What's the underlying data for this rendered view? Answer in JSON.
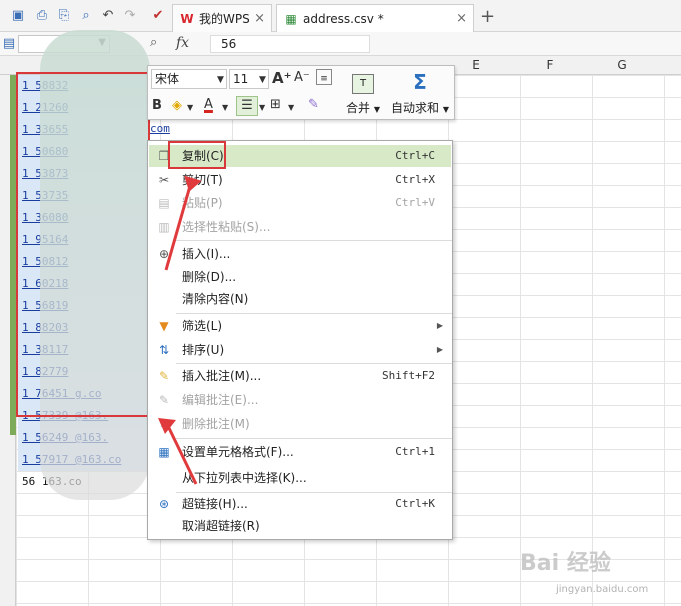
{
  "titlebar": {
    "tabs": [
      {
        "label": "我的WPS",
        "close": "×"
      },
      {
        "label": "address.csv *",
        "close": "×"
      }
    ],
    "new_tab": "+"
  },
  "formula_bar": {
    "fx_label": "fx",
    "value": "56"
  },
  "columns": [
    "E",
    "F",
    "G"
  ],
  "cells": [
    "1 58832",
    "1 21260",
    "1 33655",
    "1 50680",
    "1 53873",
    "1 53735",
    "1 36080",
    "1 95164",
    "1 50812",
    "1 60218",
    "1 56819",
    "1 88203",
    "1 38117",
    "1 82779",
    "1 76451 g.co",
    "1 57339 @163.",
    "1 56249 @163.",
    "1 57917 @163.co",
    "56 163.co"
  ],
  "row_extras": {
    "r2": "com",
    "r3": "com"
  },
  "format_toolbar": {
    "font_name": "宋体",
    "font_size": "11",
    "merge_label": "合并",
    "autosum_label": "自动求和"
  },
  "context_menu": {
    "items": [
      {
        "label": "复制(C)",
        "shortcut": "Ctrl+C",
        "icon": "copy-icon",
        "disabled": false,
        "highlighted": true
      },
      {
        "label": "剪切(T)",
        "shortcut": "Ctrl+X",
        "icon": "scissors-icon",
        "disabled": false
      },
      {
        "label": "粘贴(P)",
        "shortcut": "Ctrl+V",
        "icon": "paste-icon",
        "disabled": true
      },
      {
        "label": "选择性粘贴(S)...",
        "shortcut": "",
        "icon": "paste-special-icon",
        "disabled": true
      },
      {
        "label": "插入(I)...",
        "shortcut": "",
        "icon": "insert-icon",
        "disabled": false
      },
      {
        "label": "删除(D)...",
        "shortcut": "",
        "icon": "",
        "disabled": false
      },
      {
        "label": "清除内容(N)",
        "shortcut": "",
        "icon": "",
        "disabled": false
      },
      {
        "label": "筛选(L)",
        "shortcut": "",
        "icon": "filter-icon",
        "disabled": false,
        "submenu": true
      },
      {
        "label": "排序(U)",
        "shortcut": "",
        "icon": "sort-icon",
        "disabled": false,
        "submenu": true
      },
      {
        "label": "插入批注(M)...",
        "shortcut": "Shift+F2",
        "icon": "insert-comment-icon",
        "disabled": false
      },
      {
        "label": "编辑批注(E)...",
        "shortcut": "",
        "icon": "edit-comment-icon",
        "disabled": true
      },
      {
        "label": "删除批注(M)",
        "shortcut": "",
        "icon": "delete-comment-icon",
        "disabled": true
      },
      {
        "label": "设置单元格格式(F)...",
        "shortcut": "Ctrl+1",
        "icon": "format-cells-icon",
        "disabled": false
      },
      {
        "label": "从下拉列表中选择(K)...",
        "shortcut": "",
        "icon": "",
        "disabled": false
      },
      {
        "label": "超链接(H)...",
        "shortcut": "Ctrl+K",
        "icon": "hyperlink-icon",
        "disabled": false
      },
      {
        "label": "取消超链接(R)",
        "shortcut": "",
        "icon": "",
        "disabled": false
      }
    ]
  },
  "watermark": {
    "text": "Bai 经验",
    "sub": "jingyan.baidu.com"
  }
}
